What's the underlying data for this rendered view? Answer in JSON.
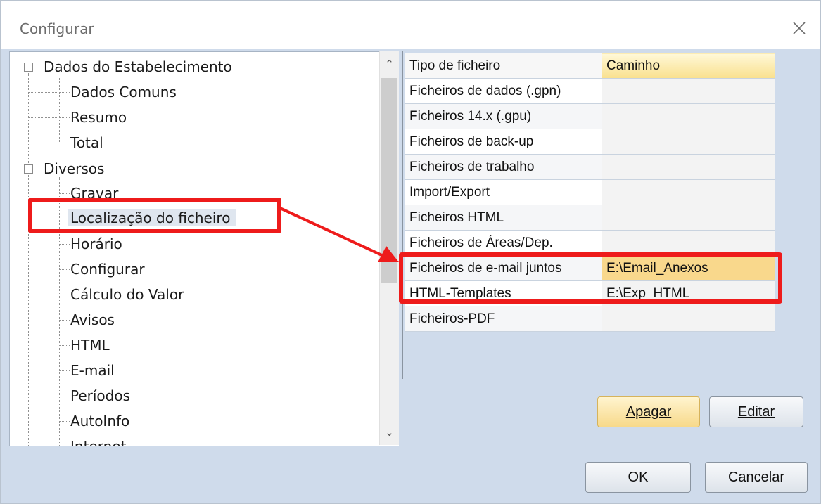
{
  "window": {
    "title": "Configurar"
  },
  "tree": {
    "items": [
      {
        "label": "Dados do Estabelecimento",
        "level": 0,
        "expanded": true
      },
      {
        "label": "Dados Comuns",
        "level": 1
      },
      {
        "label": "Resumo",
        "level": 1
      },
      {
        "label": "Total",
        "level": 1
      },
      {
        "label": "Diversos",
        "level": 0,
        "expanded": true
      },
      {
        "label": "Gravar",
        "level": 1
      },
      {
        "label": "Localização do ficheiro",
        "level": 1,
        "selected": true
      },
      {
        "label": "Horário",
        "level": 1
      },
      {
        "label": "Configurar",
        "level": 1
      },
      {
        "label": "Cálculo do Valor",
        "level": 1
      },
      {
        "label": "Avisos",
        "level": 1
      },
      {
        "label": "HTML",
        "level": 1
      },
      {
        "label": "E-mail",
        "level": 1
      },
      {
        "label": "Períodos",
        "level": 1
      },
      {
        "label": "AutoInfo",
        "level": 1
      },
      {
        "label": "Internet",
        "level": 1
      }
    ]
  },
  "grid": {
    "headers": {
      "type": "Tipo de ficheiro",
      "path": "Caminho"
    },
    "rows": [
      {
        "type": "Ficheiros de dados (.gpn)",
        "path": ""
      },
      {
        "type": "Ficheiros 14.x (.gpu)",
        "path": ""
      },
      {
        "type": "Ficheiros de back-up",
        "path": ""
      },
      {
        "type": "Ficheiros de trabalho",
        "path": ""
      },
      {
        "type": "Import/Export",
        "path": ""
      },
      {
        "type": "Ficheiros HTML",
        "path": ""
      },
      {
        "type": "Ficheiros de Áreas/Dep.",
        "path": ""
      },
      {
        "type": "Ficheiros de e-mail juntos",
        "path": "E:\\Email_Anexos",
        "selected": true
      },
      {
        "type": "HTML-Templates",
        "path": "E:\\Exp_HTML"
      },
      {
        "type": "Ficheiros-PDF",
        "path": ""
      }
    ]
  },
  "buttons": {
    "delete": {
      "label": "Apagar"
    },
    "edit": {
      "label": "Editar"
    },
    "ok": {
      "label": "OK"
    },
    "cancel": {
      "label": "Cancelar"
    }
  },
  "colors": {
    "annotation": "#ee1b1b",
    "selection": "#f9d88c"
  },
  "icons": {
    "close": "close-icon",
    "scroll_up": "chevron-up-icon",
    "scroll_down": "chevron-down-icon"
  }
}
